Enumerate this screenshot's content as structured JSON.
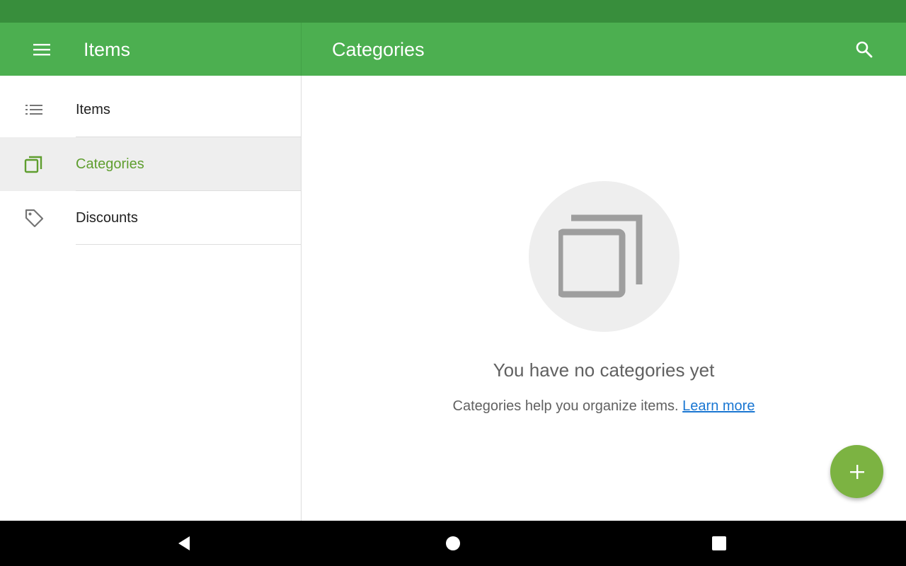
{
  "appbar": {
    "left_title": "Items",
    "main_title": "Categories",
    "menu_icon": "menu-icon",
    "search_icon": "search-icon"
  },
  "sidebar": {
    "items": [
      {
        "label": "Items",
        "icon": "list-icon",
        "selected": false
      },
      {
        "label": "Categories",
        "icon": "categories-icon",
        "selected": true
      },
      {
        "label": "Discounts",
        "icon": "tag-icon",
        "selected": false
      }
    ]
  },
  "empty_state": {
    "icon": "categories-icon",
    "title": "You have no categories yet",
    "description": "Categories help you organize items.",
    "link": "Learn more"
  },
  "fab": {
    "icon": "plus-icon"
  },
  "system_nav": {
    "back_icon": "back-icon",
    "home_icon": "home-icon",
    "recents_icon": "recents-icon"
  },
  "colors": {
    "status_bar": "#388e3c",
    "app_bar": "#4caf50",
    "selected_text": "#5f9e2f",
    "fab": "#7cb342",
    "link": "#1976d2"
  }
}
